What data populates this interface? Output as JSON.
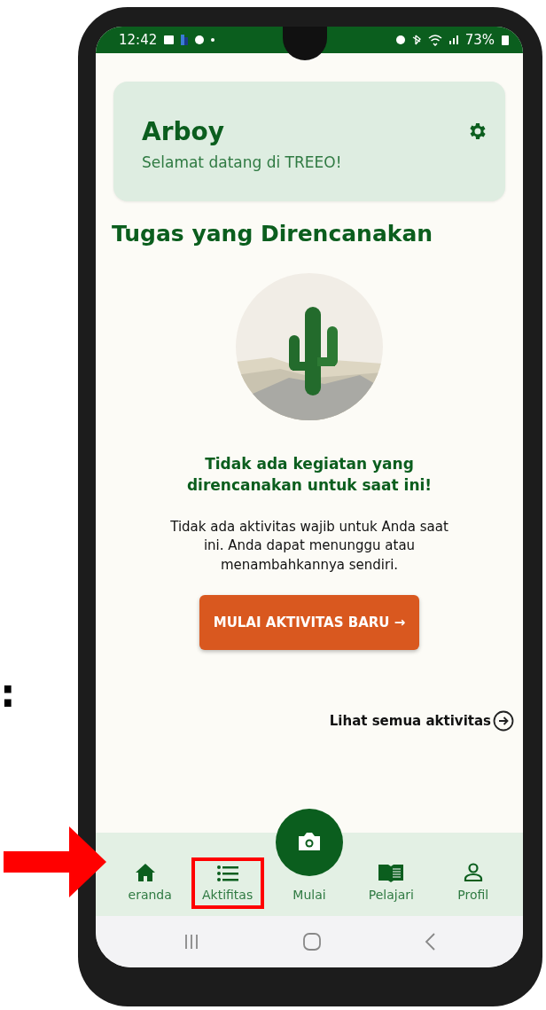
{
  "status_bar": {
    "time": "12:42",
    "battery": "73%"
  },
  "header_card": {
    "name": "Arboy",
    "greeting": "Selamat datang di TREEO!"
  },
  "section_title": "Tugas yang Direncanakan",
  "empty_state": {
    "title": "Tidak ada kegiatan yang direncanakan untuk saat ini!",
    "message": "Tidak ada aktivitas wajib untuk Anda saat ini. Anda dapat menunggu atau menambahkannya sendiri.",
    "button": "MULAI AKTIVITAS BARU",
    "button_arrow": "→"
  },
  "see_all_link": "Lihat semua aktivitas",
  "bottom_nav": [
    {
      "kind": "home",
      "label": "eranda",
      "highlighted": false
    },
    {
      "kind": "list",
      "label": "Aktifitas",
      "highlighted": true
    },
    {
      "kind": "camera",
      "label": "Mulai",
      "highlighted": false
    },
    {
      "kind": "book",
      "label": "Pelajari",
      "highlighted": false
    },
    {
      "kind": "person",
      "label": "Profil",
      "highlighted": false
    }
  ],
  "side_mark": ":"
}
